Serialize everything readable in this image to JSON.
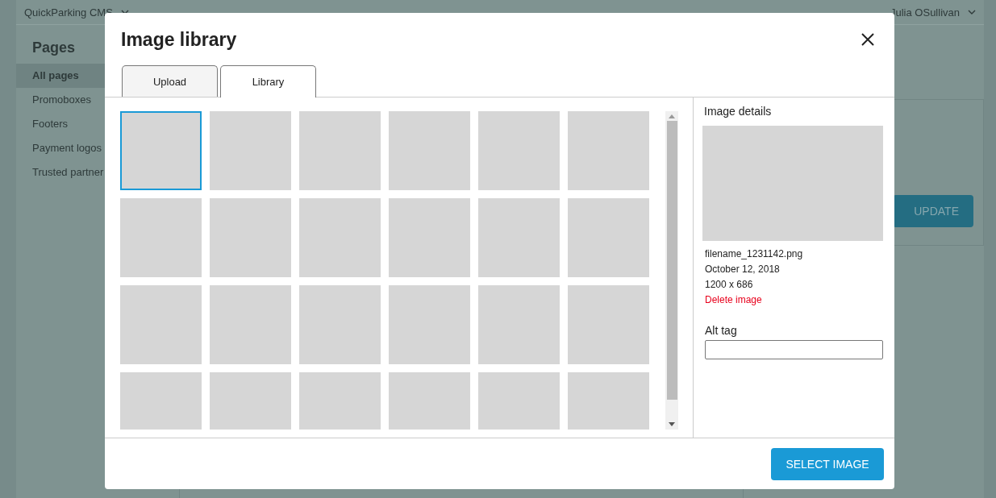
{
  "topbar": {
    "app_name": "QuickParking CMS",
    "user_name": "Julia OSullivan"
  },
  "sidebar": {
    "title": "Pages",
    "items": [
      {
        "label": "All pages",
        "selected": true
      },
      {
        "label": "Promoboxes",
        "selected": false
      },
      {
        "label": "Footers",
        "selected": false
      },
      {
        "label": "Payment logos",
        "selected": false
      },
      {
        "label": "Trusted partner",
        "selected": false
      }
    ]
  },
  "panel": {
    "button": "UPDATE"
  },
  "modal": {
    "title": "Image library",
    "tabs": [
      {
        "label": "Upload",
        "selected": false
      },
      {
        "label": "Library",
        "selected": true
      }
    ],
    "tiles": [
      {
        "selected": true
      },
      {
        "selected": false
      },
      {
        "selected": false
      },
      {
        "selected": false
      },
      {
        "selected": false
      },
      {
        "selected": false
      },
      {
        "selected": false
      },
      {
        "selected": false
      },
      {
        "selected": false
      },
      {
        "selected": false
      },
      {
        "selected": false
      },
      {
        "selected": false
      },
      {
        "selected": false
      },
      {
        "selected": false
      },
      {
        "selected": false
      },
      {
        "selected": false
      },
      {
        "selected": false
      },
      {
        "selected": false
      },
      {
        "selected": false
      },
      {
        "selected": false
      },
      {
        "selected": false
      },
      {
        "selected": false
      },
      {
        "selected": false
      },
      {
        "selected": false
      }
    ],
    "details": {
      "heading": "Image details",
      "filename": "filename_1231142.png",
      "date": "October 12, 2018",
      "dimensions": "1200 x 686",
      "delete_link": "Delete image",
      "alt_label": "Alt tag"
    },
    "select_button": "SELECT IMAGE"
  }
}
